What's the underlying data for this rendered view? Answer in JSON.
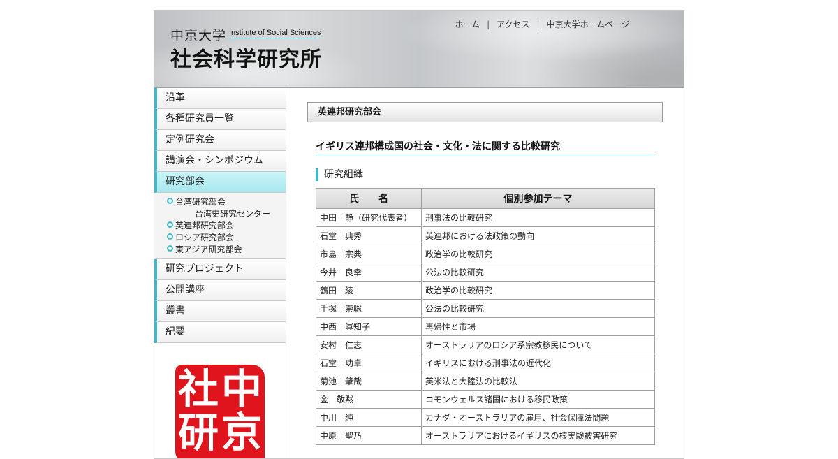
{
  "header": {
    "univ": "中京大学",
    "eng_subtitle": "Institute of Social Sciences",
    "title": "社会科学研究所",
    "topnav": [
      "ホーム",
      "アクセス",
      "中京大学ホームページ"
    ],
    "separator": "|"
  },
  "sidebar": {
    "items": [
      "沿革",
      "各種研究員一覧",
      "定例研究会",
      "講演会・シンポジウム",
      "研究部会"
    ],
    "sub_items": [
      {
        "label": "台湾研究部会"
      },
      {
        "label": "台湾史研究センター",
        "continuation": true
      },
      {
        "label": "英連邦研究部会"
      },
      {
        "label": "ロシア研究部会"
      },
      {
        "label": "東アジア研究部会"
      }
    ],
    "items_after": [
      "研究プロジェクト",
      "公開講座",
      "叢書",
      "紀要"
    ],
    "seal_chars": [
      "中",
      "京",
      "社",
      "研"
    ]
  },
  "main": {
    "section_title": "英連邦研究部会",
    "project_title": "イギリス連邦構成国の社会・文化・法に関する比較研究",
    "org_heading": "研究組織",
    "table": {
      "headers": [
        "氏　　名",
        "個別参加テーマ"
      ],
      "rows": [
        [
          "中田　静（研究代表者）",
          "刑事法の比較研究"
        ],
        [
          "石堂　典秀",
          "英連邦における法政策の動向"
        ],
        [
          "市島　宗典",
          "政治学の比較研究"
        ],
        [
          "今井　良幸",
          "公法の比較研究"
        ],
        [
          "鶴田　綾",
          "政治学の比較研究"
        ],
        [
          "手塚　崇聡",
          "公法の比較研究"
        ],
        [
          "中西　眞知子",
          "再帰性と市場"
        ],
        [
          "安村　仁志",
          "オーストラリアのロシア系宗教移民について"
        ],
        [
          "石堂　功卓",
          "イギリスにおける刑事法の近代化"
        ],
        [
          "菊池　肇哉",
          "英米法と大陸法の比較法"
        ],
        [
          "金　敬黙",
          "コモンウェルス諸国における移民政策"
        ],
        [
          "中川　純",
          "カナダ・オーストラリアの雇用、社会保障法問題"
        ],
        [
          "中原　聖乃",
          "オーストラリアにおけるイギリスの核実験被害研究"
        ]
      ]
    }
  },
  "colors": {
    "accent": "#3fb8c8",
    "seal": "#e0141c",
    "active_nav": "#b8eef2"
  }
}
